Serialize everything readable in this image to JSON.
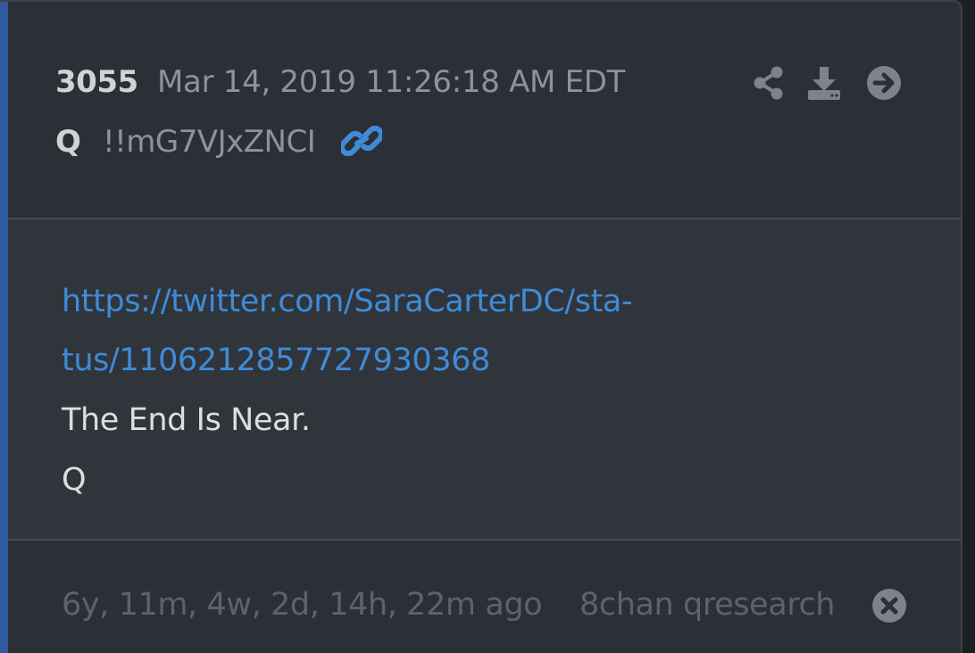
{
  "post": {
    "number": "3055",
    "date": "Mar 14, 2019 11:26:18 AM EDT",
    "author": "Q",
    "tripcode": "!!mG7VJxZNCI"
  },
  "icons": {
    "share": "share-icon",
    "download": "download-icon",
    "go": "arrow-circle-right-icon",
    "permalink": "link-icon",
    "close": "close-circle-icon"
  },
  "body": {
    "link_line_1": "https://twitter.com/SaraCarterDC/sta-",
    "link_line_2": "tus/1106212857727930368",
    "text_line_1": "The End Is Near.",
    "text_line_2": "Q"
  },
  "footer": {
    "age": "6y, 11m, 4w, 2d, 14h, 22m ago",
    "source": "8chan qresearch"
  },
  "colors": {
    "accent": "#2f5a9e",
    "link": "#3f8bd8",
    "icon": "#7d838b"
  }
}
